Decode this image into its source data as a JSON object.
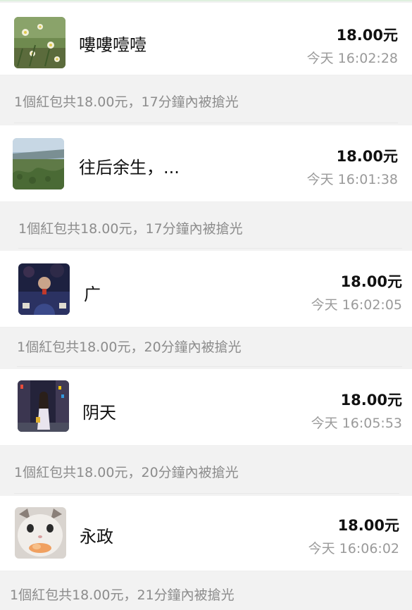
{
  "records": [
    {
      "name": "嘍嘍噎噎",
      "amount": "18.00元",
      "time": "今天 16:02:28",
      "summary": "1個紅包共18.00元，17分鐘內被搶光",
      "avatar": "flowers-photo"
    },
    {
      "name": "往后余生，...",
      "amount": "18.00元",
      "time": "今天 16:01:38",
      "summary": "1個紅包共18.00元，17分鐘內被搶光",
      "avatar": "riverside-plants-photo"
    },
    {
      "name": "广",
      "amount": "18.00元",
      "time": "今天 16:02:05",
      "summary": "1個紅包共18.00元，20分鐘內被搶光",
      "avatar": "night-person-photo"
    },
    {
      "name": "阴天",
      "amount": "18.00元",
      "time": "今天 16:05:53",
      "summary": "1個紅包共18.00元，20分鐘內被搶光",
      "avatar": "street-girl-photo"
    },
    {
      "name": "永政",
      "amount": "18.00元",
      "time": "今天 16:06:02",
      "summary": "1個紅包共18.00元，21分鐘內被搶光",
      "avatar": "cat-photo"
    }
  ]
}
